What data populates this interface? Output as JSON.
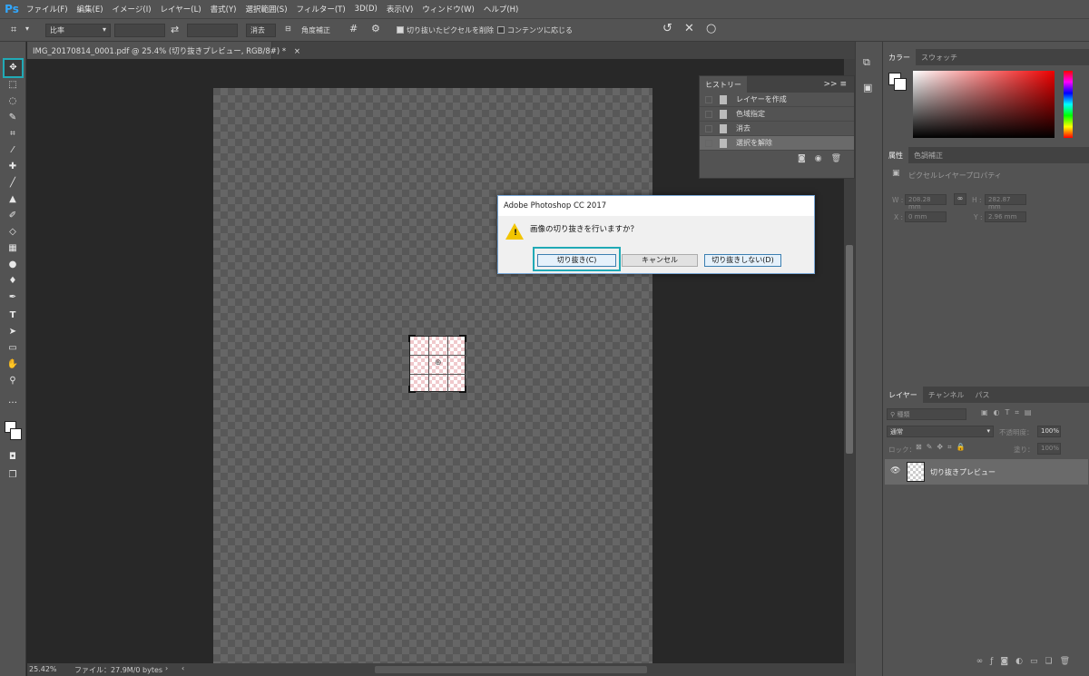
{
  "app": {
    "logo": "Ps"
  },
  "menu": [
    "ファイル(F)",
    "編集(E)",
    "イメージ(I)",
    "レイヤー(L)",
    "書式(Y)",
    "選択範囲(S)",
    "フィルター(T)",
    "3D(D)",
    "表示(V)",
    "ウィンドウ(W)",
    "ヘルプ(H)"
  ],
  "options_bar": {
    "ratio": "比率",
    "clear": "消去",
    "straighten": "角度補正",
    "delete_cropped": "切り抜いたピクセルを削除",
    "content_aware": "コンテンツに応じる"
  },
  "document": {
    "tab_title": "IMG_20170814_0001.pdf @ 25.4% (切り抜きプレビュー, RGB/8#) *",
    "tab_close": "×"
  },
  "status": {
    "zoom": "25.42%",
    "file_info": "ファイル：27.9M/0 bytes"
  },
  "history": {
    "tab": "ヒストリー",
    "collapse": ">>",
    "items": [
      "レイヤーを作成",
      "色域指定",
      "消去",
      "選択を解除"
    ],
    "selected_index": 3
  },
  "color_panel": {
    "tabs": [
      "カラー",
      "スウォッチ"
    ]
  },
  "properties_panel": {
    "tabs": [
      "属性",
      "色調補正"
    ],
    "title": "ピクセルレイヤープロパティ",
    "w_label": "W :",
    "w_value": "208.28 mm",
    "h_label": "H :",
    "h_value": "282.87 mm",
    "x_label": "X :",
    "x_value": "0 mm",
    "y_label": "Y :",
    "y_value": "2.96 mm"
  },
  "layers_panel": {
    "tabs": [
      "レイヤー",
      "チャンネル",
      "パス"
    ],
    "kind": "種類",
    "blend": "通常",
    "opacity_label": "不透明度：",
    "opacity": "100%",
    "lock_label": "ロック：",
    "fill_label": "塗り：",
    "fill": "100%",
    "layer_name": "切り抜きプレビュー"
  },
  "dialog": {
    "title": "Adobe Photoshop CC 2017",
    "message": "画像の切り抜きを行いますか？",
    "crop_button": "切り抜き(C)",
    "cancel_button": "キャンセル",
    "dont_crop_button": "切り抜きしない(D)"
  },
  "colors": {
    "highlight": "#21aab6",
    "ps_blue": "#31a8ff"
  }
}
